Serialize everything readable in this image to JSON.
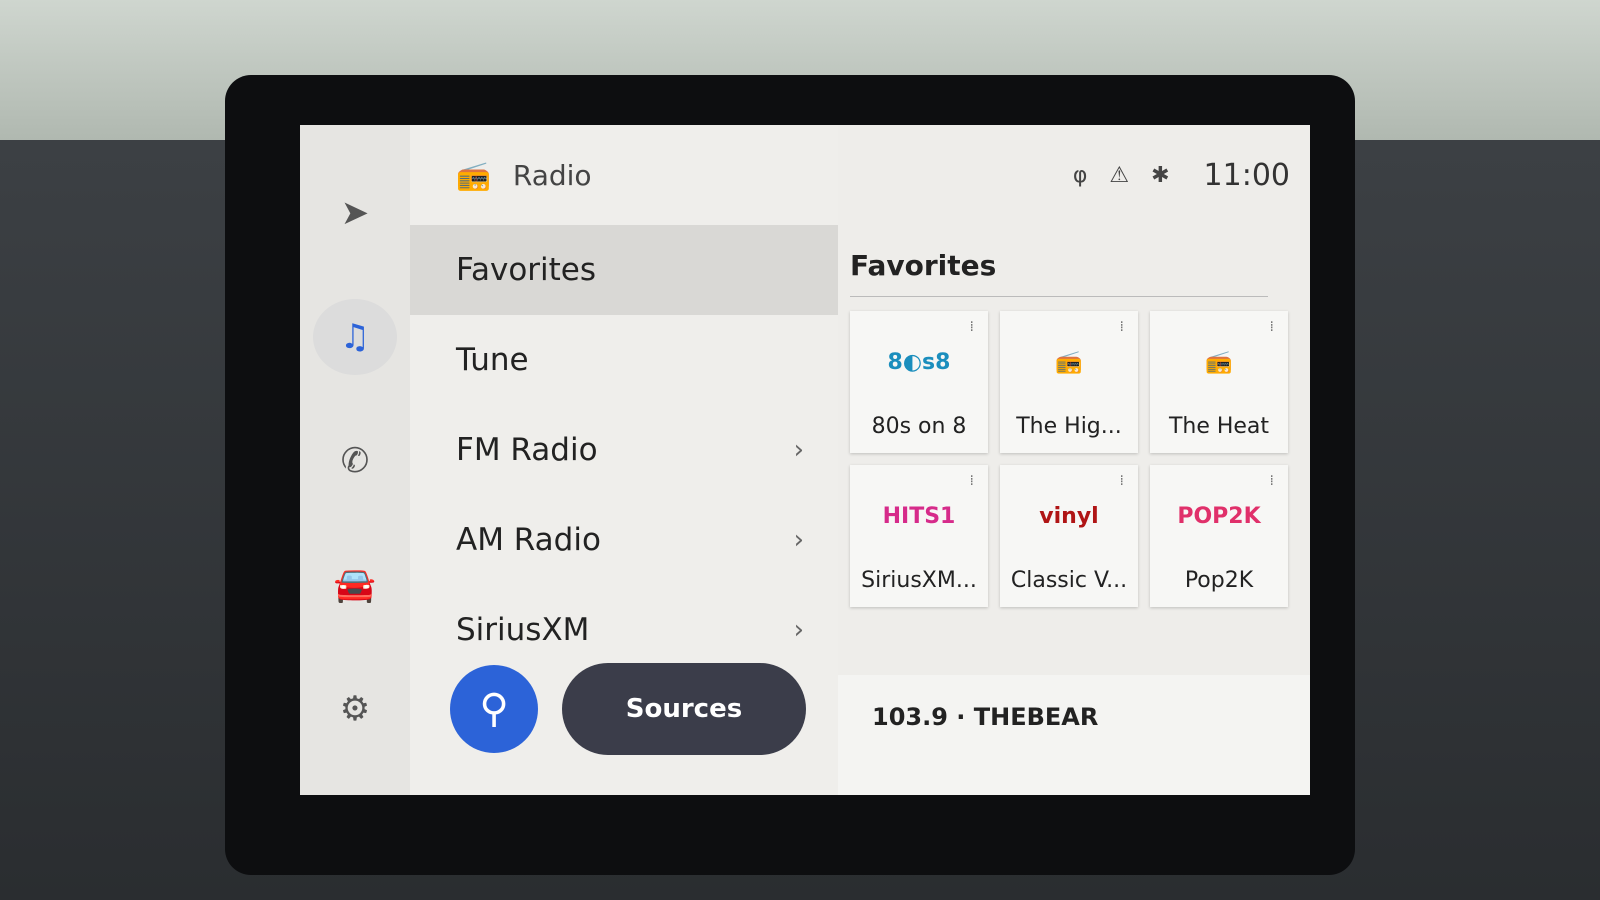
{
  "header": {
    "title": "Radio",
    "icon": "radio-icon"
  },
  "rail": [
    {
      "icon": "navigation-icon",
      "glyph": "➤"
    },
    {
      "icon": "music-note-icon",
      "glyph": "♫",
      "active": true
    },
    {
      "icon": "phone-icon",
      "glyph": "✆"
    },
    {
      "icon": "car-icon",
      "glyph": "🚘"
    },
    {
      "icon": "gear-icon",
      "glyph": "⚙"
    }
  ],
  "menu": [
    {
      "label": "Favorites",
      "selected": true
    },
    {
      "label": "Tune"
    },
    {
      "label": "FM Radio",
      "chevron": "›"
    },
    {
      "label": "AM Radio",
      "chevron": "›"
    },
    {
      "label": "SiriusXM",
      "chevron": "›"
    }
  ],
  "buttons": {
    "search_glyph": "⚲",
    "sources": "Sources"
  },
  "status": {
    "icons": [
      "wireless-charging-icon",
      "seatbelt-off-icon",
      "bluetooth-icon"
    ],
    "glyphs": [
      "φ",
      "⚠",
      "✱"
    ],
    "time": "11:00"
  },
  "favorites": {
    "title": "Favorites",
    "tiles": [
      {
        "name": "80s on 8",
        "logo": "8◐s8",
        "color": "#1b8ebd"
      },
      {
        "name": "The Hig...",
        "logo": "📻",
        "color": "#666666"
      },
      {
        "name": "The Heat",
        "logo": "📻",
        "color": "#666666"
      },
      {
        "name": "SiriusXM...",
        "logo": "HITS1",
        "color": "#d62b8a"
      },
      {
        "name": "Classic V...",
        "logo": "vinyl",
        "color": "#b01515"
      },
      {
        "name": "Pop2K",
        "logo": "POP2K",
        "color": "#e0306a"
      }
    ]
  },
  "now_playing": "103.9 · THEBEAR",
  "colors": {
    "accent": "#2c63d8",
    "sources_button": "#3b3d4a"
  }
}
